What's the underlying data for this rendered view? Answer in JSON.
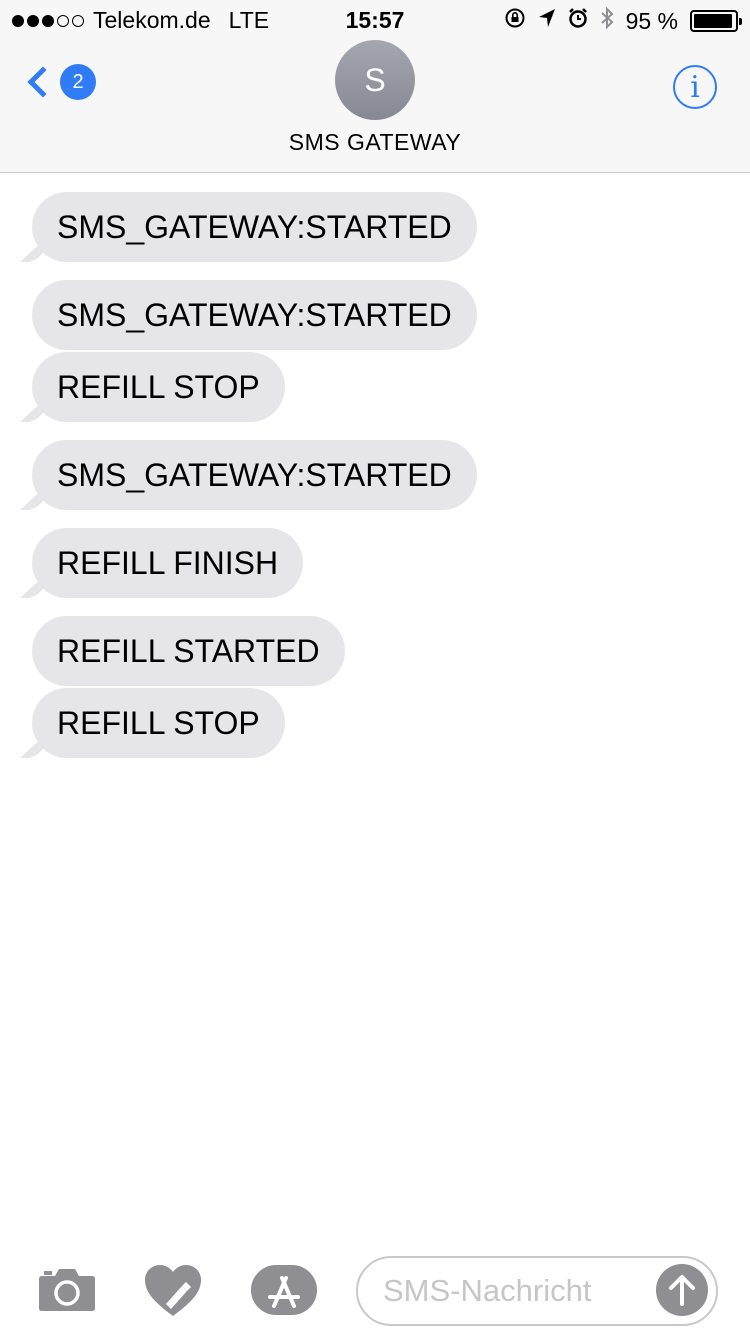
{
  "status_bar": {
    "carrier": "Telekom.de",
    "network": "LTE",
    "time": "15:57",
    "battery_percent": "95 %",
    "battery_level": 0.95,
    "signal_bars": 3,
    "signal_total": 5,
    "icons": [
      "orientation-lock-icon",
      "location-arrow-icon",
      "alarm-icon",
      "bluetooth-icon",
      "battery-icon"
    ]
  },
  "header": {
    "back_badge": "2",
    "avatar_initial": "S",
    "contact_name": "SMS GATEWAY",
    "info_label": "i"
  },
  "messages": [
    {
      "text": "SMS_GATEWAY:STARTED"
    },
    {
      "text": "SMS_GATEWAY:STARTED"
    },
    {
      "text": "REFILL STOP"
    },
    {
      "text": "SMS_GATEWAY:STARTED"
    },
    {
      "text": "REFILL FINISH"
    },
    {
      "text": "REFILL STARTED"
    },
    {
      "text": "REFILL STOP"
    }
  ],
  "input_bar": {
    "placeholder": "SMS-Nachricht",
    "icons": [
      "camera-icon",
      "digital-touch-icon",
      "app-store-icon",
      "send-arrow-icon"
    ]
  },
  "colors": {
    "accent": "#2f7cf6",
    "bubble": "#e5e5ea",
    "bar_background": "#f7f7f7"
  }
}
